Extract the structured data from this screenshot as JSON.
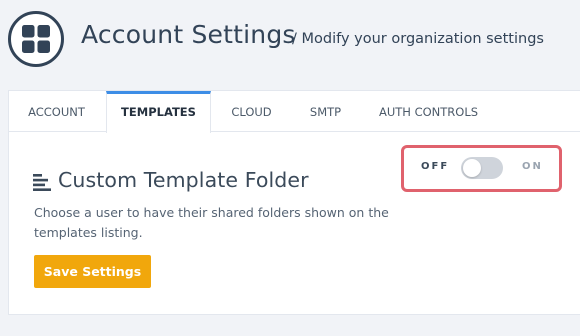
{
  "header": {
    "title": "Account Settings",
    "subtitle": "/ Modify your organization settings",
    "logo_icon": "grid-icon"
  },
  "tabs": [
    {
      "label": "ACCOUNT",
      "active": false
    },
    {
      "label": "TEMPLATES",
      "active": true
    },
    {
      "label": "CLOUD",
      "active": false
    },
    {
      "label": "SMTP",
      "active": false
    },
    {
      "label": "AUTH CONTROLS",
      "active": false
    }
  ],
  "section": {
    "icon": "align-left-icon",
    "title": "Custom Template Folder",
    "description": "Choose a user to have their shared folders shown on the templates listing."
  },
  "toggle": {
    "off_label": "OFF",
    "on_label": "ON",
    "state": "off"
  },
  "actions": {
    "save_label": "Save Settings"
  },
  "colors": {
    "accent_tab": "#3d8de6",
    "button": "#f1a70c",
    "highlight_border": "#e0626d",
    "background": "#f1f3f7"
  }
}
